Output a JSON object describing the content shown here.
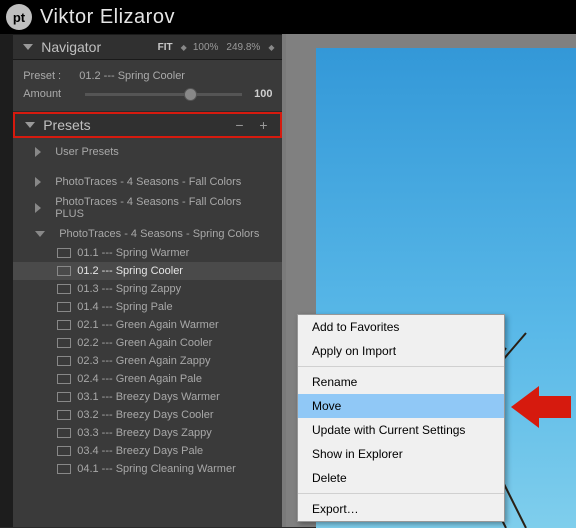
{
  "topbar": {
    "logo_text": "pt",
    "title": "Viktor Elizarov"
  },
  "navigator": {
    "title": "Navigator",
    "fit_label": "FIT",
    "zoom_levels": [
      "100%",
      "249.8%"
    ]
  },
  "preset_info": {
    "preset_label": "Preset :",
    "preset_name": "01.2 --- Spring Cooler",
    "amount_label": "Amount",
    "amount_value": "100"
  },
  "presets_panel": {
    "title": "Presets",
    "minus": "−",
    "plus": "+"
  },
  "tree": {
    "user_presets": "User Presets",
    "groups": [
      "PhotoTraces - 4 Seasons - Fall Colors",
      "PhotoTraces - 4 Seasons - Fall Colors PLUS",
      "PhotoTraces - 4 Seasons - Spring Colors"
    ],
    "items": [
      "01.1 --- Spring Warmer",
      "01.2 --- Spring Cooler",
      "01.3 --- Spring Zappy",
      "01.4 --- Spring Pale",
      "02.1 --- Green Again Warmer",
      "02.2 --- Green Again Cooler",
      "02.3 --- Green Again Zappy",
      "02.4 --- Green Again Pale",
      "03.1 --- Breezy Days Warmer",
      "03.2 --- Breezy Days Cooler",
      "03.3 --- Breezy Days Zappy",
      "03.4 --- Breezy Days Pale",
      "04.1 --- Spring Cleaning Warmer"
    ],
    "selected_index": 1
  },
  "context_menu": {
    "items": [
      {
        "label": "Add to Favorites",
        "sep_after": false
      },
      {
        "label": "Apply on Import",
        "sep_after": true
      },
      {
        "label": "Rename",
        "sep_after": false
      },
      {
        "label": "Move",
        "sep_after": false,
        "highlight": true
      },
      {
        "label": "Update with Current Settings",
        "sep_after": false
      },
      {
        "label": "Show in Explorer",
        "sep_after": false
      },
      {
        "label": "Delete",
        "sep_after": true
      },
      {
        "label": "Export…",
        "sep_after": false
      }
    ]
  }
}
